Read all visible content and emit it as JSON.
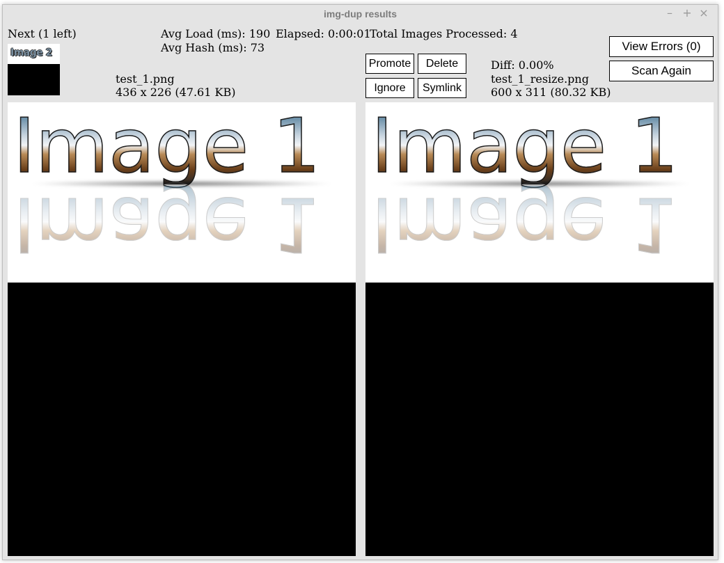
{
  "window": {
    "title": "img-dup results"
  },
  "controls": {
    "minimize": "–",
    "maximize": "+",
    "close": "×"
  },
  "stats": {
    "next": "Next (1 left)",
    "avg_load": "Avg Load (ms): 190",
    "avg_hash": "Avg Hash (ms): 73",
    "elapsed": "Elapsed: 0:00:01",
    "total": "Total Images Processed: 4"
  },
  "thumbnail": {
    "label": "Image 2"
  },
  "left_image": {
    "filename": "test_1.png",
    "info": "436 x 226 (47.61 KB)",
    "text": "Image 1",
    "reflection": "Image 1"
  },
  "right_image": {
    "diff": "Diff: 0.00%",
    "filename": "test_1_resize.png",
    "info": "600 x 311 (80.32 KB)",
    "text": "Image 1",
    "reflection": "Image 1"
  },
  "actions": {
    "promote": "Promote",
    "delete": "Delete",
    "ignore": "Ignore",
    "symlink": "Symlink",
    "view_errors": "View Errors (0)",
    "scan_again": "Scan Again"
  }
}
